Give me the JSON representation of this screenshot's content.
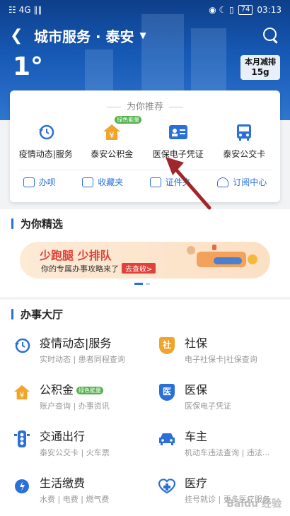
{
  "status_bar": {
    "left": "☷ 4G ∥∥",
    "right_icons": "◉ ☾ ▯",
    "battery": "74",
    "time": "03:13"
  },
  "header": {
    "title": "城市服务 · 泰安",
    "temperature": "1°",
    "carbon_label": "本月减排",
    "carbon_value": "15g"
  },
  "recommend": {
    "heading": "为你推荐",
    "items": [
      {
        "label": "疫情动态|服务",
        "icon": "clock-refresh-icon"
      },
      {
        "label": "泰安公积金",
        "icon": "house-yuan-icon",
        "tag": "绿色能量"
      },
      {
        "label": "医保电子凭证",
        "icon": "id-card-icon"
      },
      {
        "label": "泰安公交卡",
        "icon": "bus-card-icon"
      }
    ],
    "quick": [
      "办呗",
      "收藏夹",
      "证件夹",
      "订阅中心"
    ]
  },
  "featured": {
    "title": "为你精选",
    "banner_title": "少跑腿 少排队",
    "banner_sub": "你的专属办事攻略来了",
    "banner_button": "去查收>"
  },
  "hall": {
    "title": "办事大厅",
    "services": [
      {
        "name": "疫情动态|服务",
        "sub": "实时动态 | 患者同程查询",
        "icon": "clock-refresh-icon",
        "color": "#2a70d8"
      },
      {
        "name": "社保",
        "sub": "电子社保卡|社保查询",
        "icon": "social-security-shield-icon",
        "color": "#f0a52a",
        "glyph": "社"
      },
      {
        "name": "公积金",
        "sub": "账户查询 | 办事资讯",
        "icon": "house-yuan-icon",
        "color": "#f0a52a",
        "tag": "绿色能量"
      },
      {
        "name": "医保",
        "sub": "医保电子凭证",
        "icon": "medical-shield-icon",
        "color": "#2a70d8",
        "glyph": "医"
      },
      {
        "name": "交通出行",
        "sub": "泰安公交卡 | 火车票",
        "icon": "traffic-light-icon",
        "color": "#2a70d8"
      },
      {
        "name": "车主",
        "sub": "机动车违法查询 | 违法...",
        "icon": "car-icon",
        "color": "#2a70d8"
      },
      {
        "name": "生活缴费",
        "sub": "水费 | 电费 | 燃气费",
        "icon": "water-drop-icon",
        "color": "#2a70d8"
      },
      {
        "name": "医疗",
        "sub": "挂号就诊 | 更多医疗服务",
        "icon": "medical-cross-icon",
        "color": "#2a70d8"
      }
    ]
  },
  "watermark": "Baidu 经验"
}
